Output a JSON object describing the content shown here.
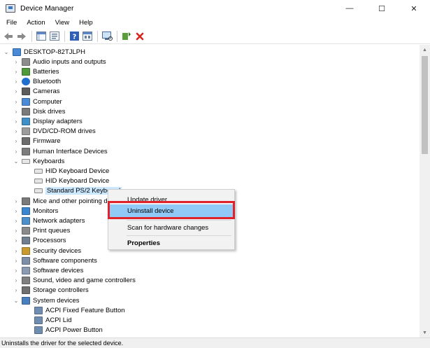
{
  "window": {
    "title": "Device Manager",
    "minimize": "—",
    "maximize": "☐",
    "close": "✕"
  },
  "menu": [
    "File",
    "Action",
    "View",
    "Help"
  ],
  "toolbar": {
    "buttons": [
      "back-icon",
      "forward-icon",
      "show-hide-console-tree-icon",
      "properties-icon",
      "help-icon",
      "view-icon",
      "scan-hardware-icon",
      "update-driver-icon",
      "uninstall-icon"
    ]
  },
  "tree": {
    "root": "DESKTOP-82TJLPH",
    "items": [
      {
        "label": "Audio inputs and outputs",
        "icon": "speaker-icon",
        "expanded": false
      },
      {
        "label": "Batteries",
        "icon": "battery-icon",
        "expanded": false
      },
      {
        "label": "Bluetooth",
        "icon": "bluetooth-icon",
        "expanded": false
      },
      {
        "label": "Cameras",
        "icon": "camera-icon",
        "expanded": false
      },
      {
        "label": "Computer",
        "icon": "computer-icon",
        "expanded": false
      },
      {
        "label": "Disk drives",
        "icon": "disk-icon",
        "expanded": false
      },
      {
        "label": "Display adapters",
        "icon": "display-icon",
        "expanded": false
      },
      {
        "label": "DVD/CD-ROM drives",
        "icon": "dvd-icon",
        "expanded": false
      },
      {
        "label": "Firmware",
        "icon": "firmware-icon",
        "expanded": false
      },
      {
        "label": "Human Interface Devices",
        "icon": "hid-icon",
        "expanded": false
      },
      {
        "label": "Keyboards",
        "icon": "keyboard-icon",
        "expanded": true
      },
      {
        "label": "HID Keyboard Device",
        "icon": "keyboard-icon",
        "child": true
      },
      {
        "label": "HID Keyboard Device",
        "icon": "keyboard-icon",
        "child": true
      },
      {
        "label": "Standard PS/2 Keyboard",
        "icon": "keyboard-icon",
        "child": true,
        "selected": true
      },
      {
        "label": "Mice and other pointing devices",
        "icon": "mouse-icon",
        "expanded": false
      },
      {
        "label": "Monitors",
        "icon": "monitor-icon",
        "expanded": false
      },
      {
        "label": "Network adapters",
        "icon": "network-icon",
        "expanded": false
      },
      {
        "label": "Print queues",
        "icon": "printer-icon",
        "expanded": false
      },
      {
        "label": "Processors",
        "icon": "processor-icon",
        "expanded": false
      },
      {
        "label": "Security devices",
        "icon": "security-icon",
        "expanded": false
      },
      {
        "label": "Software components",
        "icon": "software-component-icon",
        "expanded": false
      },
      {
        "label": "Software devices",
        "icon": "software-device-icon",
        "expanded": false
      },
      {
        "label": "Sound, video and game controllers",
        "icon": "sound-icon",
        "expanded": false
      },
      {
        "label": "Storage controllers",
        "icon": "storage-icon",
        "expanded": false
      },
      {
        "label": "System devices",
        "icon": "system-icon",
        "expanded": true
      },
      {
        "label": "ACPI Fixed Feature Button",
        "icon": "system-device-icon",
        "child": true
      },
      {
        "label": "ACPI Lid",
        "icon": "system-device-icon",
        "child": true
      },
      {
        "label": "ACPI Power Button",
        "icon": "system-device-icon",
        "child": true
      }
    ]
  },
  "context_menu": {
    "items": [
      {
        "label": "Update driver"
      },
      {
        "label": "Uninstall device",
        "highlighted": true
      },
      {
        "label": "Scan for hardware changes"
      },
      {
        "label": "Properties",
        "bold": true
      }
    ]
  },
  "status_bar": {
    "text": "Uninstalls the driver for the selected device."
  },
  "colors": {
    "selection": "#cce8ff",
    "menu_highlight": "#91c9f7",
    "callout_border": "#e0222d"
  }
}
